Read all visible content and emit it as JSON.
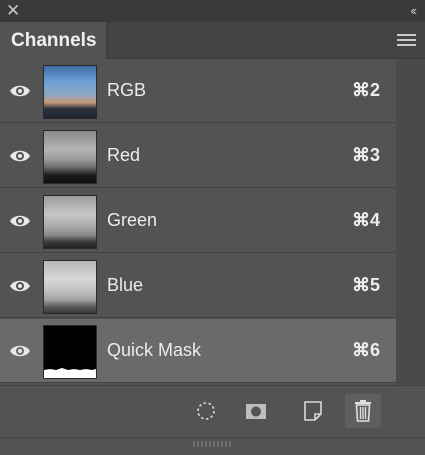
{
  "panel": {
    "tab_label": "Channels",
    "close_symbol": "✕",
    "collapse_symbol": "‹‹"
  },
  "channels": [
    {
      "name": "RGB",
      "shortcut": "⌘2",
      "visible": true,
      "selected": false
    },
    {
      "name": "Red",
      "shortcut": "⌘3",
      "visible": true,
      "selected": false
    },
    {
      "name": "Green",
      "shortcut": "⌘4",
      "visible": true,
      "selected": false
    },
    {
      "name": "Blue",
      "shortcut": "⌘5",
      "visible": true,
      "selected": false
    },
    {
      "name": "Quick Mask",
      "shortcut": "⌘6",
      "visible": true,
      "selected": true
    }
  ],
  "footer": {
    "buttons": [
      "selection-icon",
      "mask-icon",
      "new-channel-icon",
      "trash-icon"
    ]
  },
  "colors": {
    "panel_bg": "#535353",
    "selected_row": "#6a6a6a",
    "titlebar": "#3a3a3a"
  }
}
